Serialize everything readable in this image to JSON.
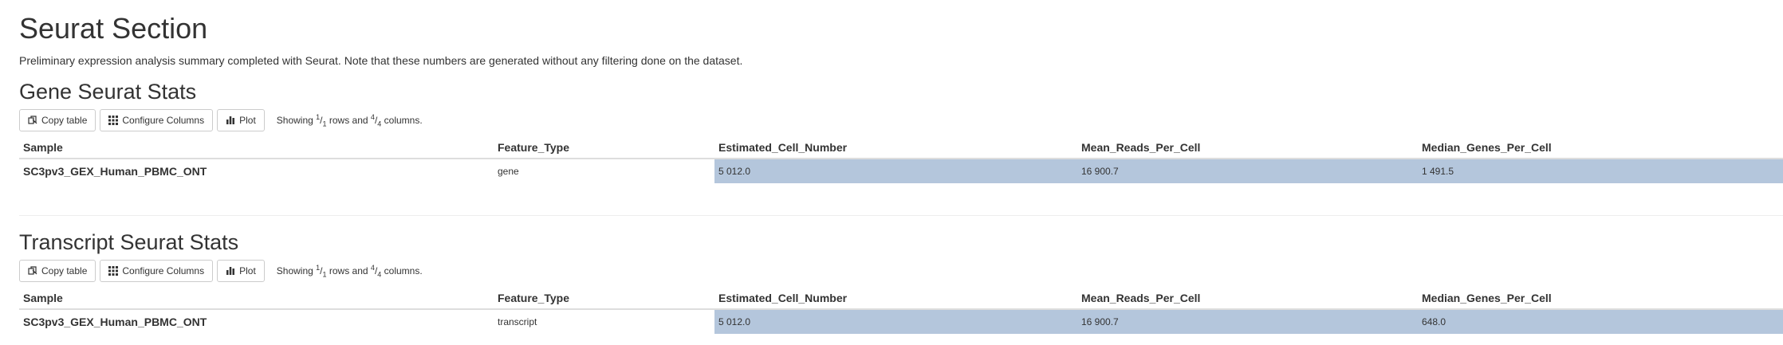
{
  "page": {
    "title": "Seurat Section",
    "description": "Preliminary expression analysis summary completed with Seurat. Note that these numbers are generated without any filtering done on the dataset."
  },
  "toolbar": {
    "copy_label": "Copy table",
    "configure_label": "Configure Columns",
    "plot_label": "Plot",
    "showing_prefix": "Showing",
    "rows_num": "1",
    "rows_den": "1",
    "rows_word": "rows and",
    "cols_num": "4",
    "cols_den": "4",
    "cols_word": "columns."
  },
  "columns": [
    "Sample",
    "Feature_Type",
    "Estimated_Cell_Number",
    "Mean_Reads_Per_Cell",
    "Median_Genes_Per_Cell"
  ],
  "sections": [
    {
      "heading": "Gene Seurat Stats",
      "row": [
        "SC3pv3_GEX_Human_PBMC_ONT",
        "gene",
        "5 012.0",
        "16 900.7",
        "1 491.5"
      ]
    },
    {
      "heading": "Transcript Seurat Stats",
      "row": [
        "SC3pv3_GEX_Human_PBMC_ONT",
        "transcript",
        "5 012.0",
        "16 900.7",
        "648.0"
      ]
    }
  ],
  "colors": {
    "highlight": "#b4c6dc",
    "border": "#dddddd",
    "text": "#333333"
  },
  "icons": [
    "copy-icon",
    "columns-grid-icon",
    "bar-chart-icon"
  ]
}
